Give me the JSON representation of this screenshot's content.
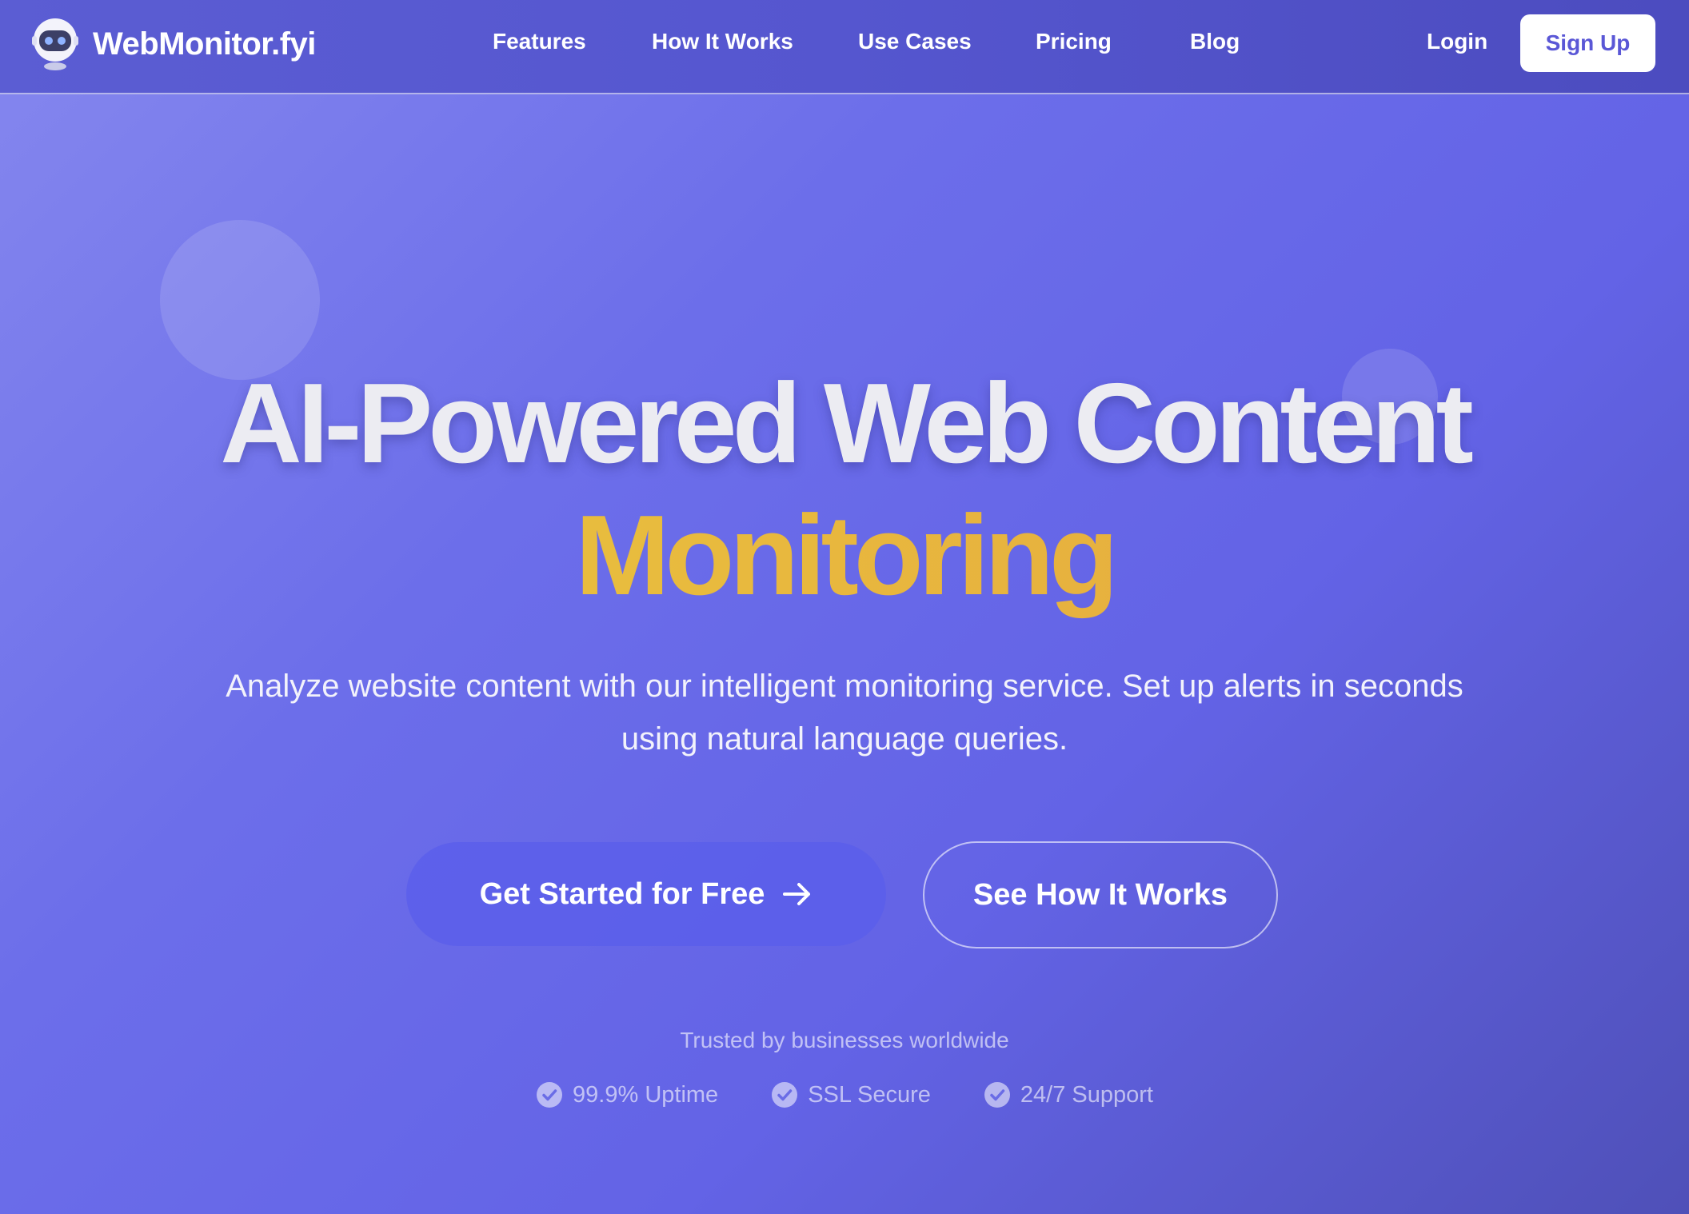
{
  "header": {
    "brand": "WebMonitor.fyi",
    "logo_icon": "robot-icon",
    "nav": [
      {
        "label": "Features"
      },
      {
        "label": "How It Works"
      },
      {
        "label": "Use Cases"
      },
      {
        "label": "Pricing"
      },
      {
        "label": "Blog"
      }
    ],
    "login_label": "Login",
    "signup_label": "Sign Up"
  },
  "hero": {
    "title_line1": "AI-Powered Web Content",
    "title_line2": "Monitoring",
    "subtitle": "Analyze website content with our intelligent monitoring service. Set up alerts in seconds using natural language queries.",
    "primary_cta": "Get Started for Free",
    "primary_cta_icon": "arrow-right-icon",
    "secondary_cta": "See How It Works"
  },
  "trust": {
    "label": "Trusted by businesses worldwide",
    "badge_icon": "check-circle-icon",
    "badges": [
      {
        "label": "99.9% Uptime"
      },
      {
        "label": "SSL Secure"
      },
      {
        "label": "24/7 Support"
      }
    ]
  },
  "colors": {
    "accent": "#5a57d6",
    "highlight_start": "#e9c93e",
    "highlight_end": "#e6a53f"
  }
}
